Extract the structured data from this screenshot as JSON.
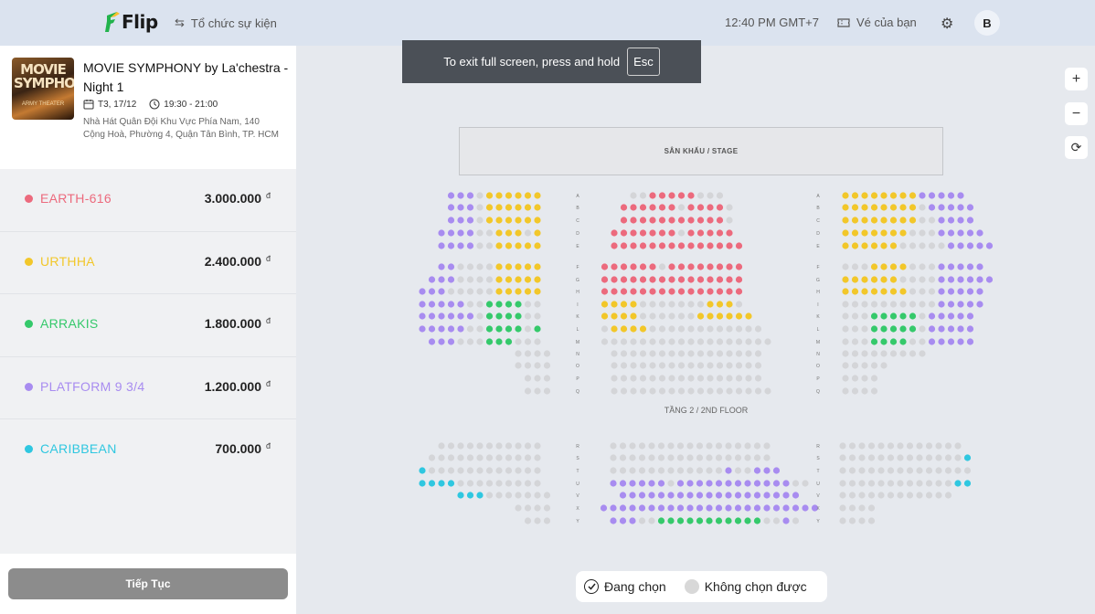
{
  "header": {
    "logo": "Flip",
    "organize_label": "Tổ chức sự kiện",
    "time": "12:40 PM GMT+7",
    "tickets_label": "Vé của bạn",
    "avatar_initial": "B"
  },
  "fullscreen_notice": {
    "text": "To exit full screen, press and hold",
    "key": "Esc"
  },
  "event": {
    "title": "MOVIE SYMPHONY by La'chestra - Night 1",
    "date": "T3, 17/12",
    "time": "19:30 - 21:00",
    "address": "Nhà Hát Quân Đội Khu Vực Phía Nam, 140 Cộng Hoà, Phường 4, Quận Tân Bình, TP. HCM",
    "poster_title": "MOVIE SYMPHONY",
    "poster_caption": "ARMY THEATER"
  },
  "tiers": [
    {
      "name": "EARTH-616",
      "price": "3.000.000",
      "currency": "đ",
      "color": "#ec6a7d"
    },
    {
      "name": "URTHHA",
      "price": "2.400.000",
      "currency": "đ",
      "color": "#f2c72a"
    },
    {
      "name": "ARRAKIS",
      "price": "1.800.000",
      "currency": "đ",
      "color": "#35c96b"
    },
    {
      "name": "PLATFORM 9 3/4",
      "price": "1.200.000",
      "currency": "đ",
      "color": "#a88cf0"
    },
    {
      "name": "CARIBBEAN",
      "price": "700.000",
      "currency": "đ",
      "color": "#2fc7e0"
    }
  ],
  "continue_label": "Tiếp Tục",
  "stage_label": "SÂN KHẤU / STAGE",
  "floor2_label": "TẦNG 2 / 2ND FLOOR",
  "row_labels_floor1": [
    "A",
    "B",
    "C",
    "D",
    "E",
    "F",
    "G",
    "H",
    "I",
    "K",
    "L",
    "M",
    "N",
    "O",
    "P",
    "Q"
  ],
  "row_labels_floor2": [
    "R",
    "S",
    "T",
    "U",
    "V",
    "X",
    "Y"
  ],
  "legend": {
    "selecting": "Đang chọn",
    "unavailable": "Không chọn được"
  },
  "zoom": {
    "in": "+",
    "out": "−",
    "reset": "⟳"
  },
  "colors": {
    "unavailable": "#d4d5d8",
    "header_bg": "#dbe3ef",
    "button": "#8c8c8c"
  }
}
